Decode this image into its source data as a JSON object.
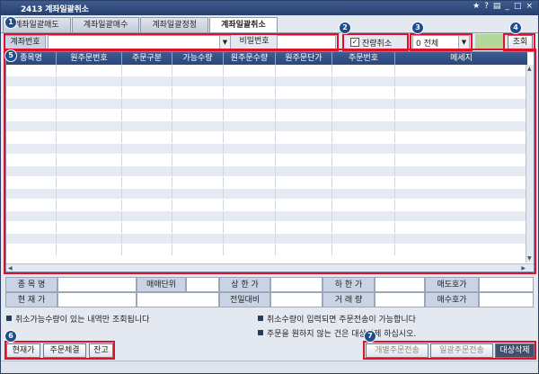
{
  "window": {
    "title": "2413 계좌일괄취소",
    "controls": [
      "★",
      "?",
      "▤",
      "_",
      "□",
      "×"
    ]
  },
  "tabs": [
    "계좌일괄매도",
    "계좌일괄매수",
    "계좌일괄정정",
    "계좌일괄취소"
  ],
  "form": {
    "account_label": "계좌번호",
    "account_value": "",
    "password_label": "비밀번호",
    "password_value": "",
    "remain_cancel_label": "잔량취소",
    "remain_cancel_checked": true,
    "select_value": "0 전체",
    "query_button": "조회"
  },
  "badges": [
    "1",
    "2",
    "3",
    "4",
    "5",
    "6",
    "7"
  ],
  "grid": {
    "columns": [
      "종목명",
      "원주문번호",
      "주문구분",
      "가능수량",
      "원주문수량",
      "원주문단가",
      "주문번호",
      "메세지"
    ],
    "row_count": 17
  },
  "info": {
    "row1": [
      "종 목 명",
      "",
      "매매단위",
      "",
      "상 한 가",
      "",
      "하 한 가",
      "",
      "매도호가",
      ""
    ],
    "row2": [
      "현 재 가",
      "",
      "",
      "",
      "전일대비",
      "",
      "거 래 량",
      "",
      "매수호가",
      ""
    ]
  },
  "notes": {
    "left": "취소가능수량이 있는 내역만 조회됩니다",
    "right1": "취소수량이 입력되면 주문전송이 가능합니다",
    "right2": "주문을 원하지 않는 건은 대상삭제 하십시오."
  },
  "bottom_left_buttons": [
    "현재가",
    "주문체결",
    "잔고"
  ],
  "bottom_right_buttons": [
    "개별주문전송",
    "일괄주문전송",
    "대상삭제"
  ],
  "colors": {
    "accent": "#2b4679",
    "highlight": "#e0102a",
    "badge": "#1d4f8f"
  }
}
